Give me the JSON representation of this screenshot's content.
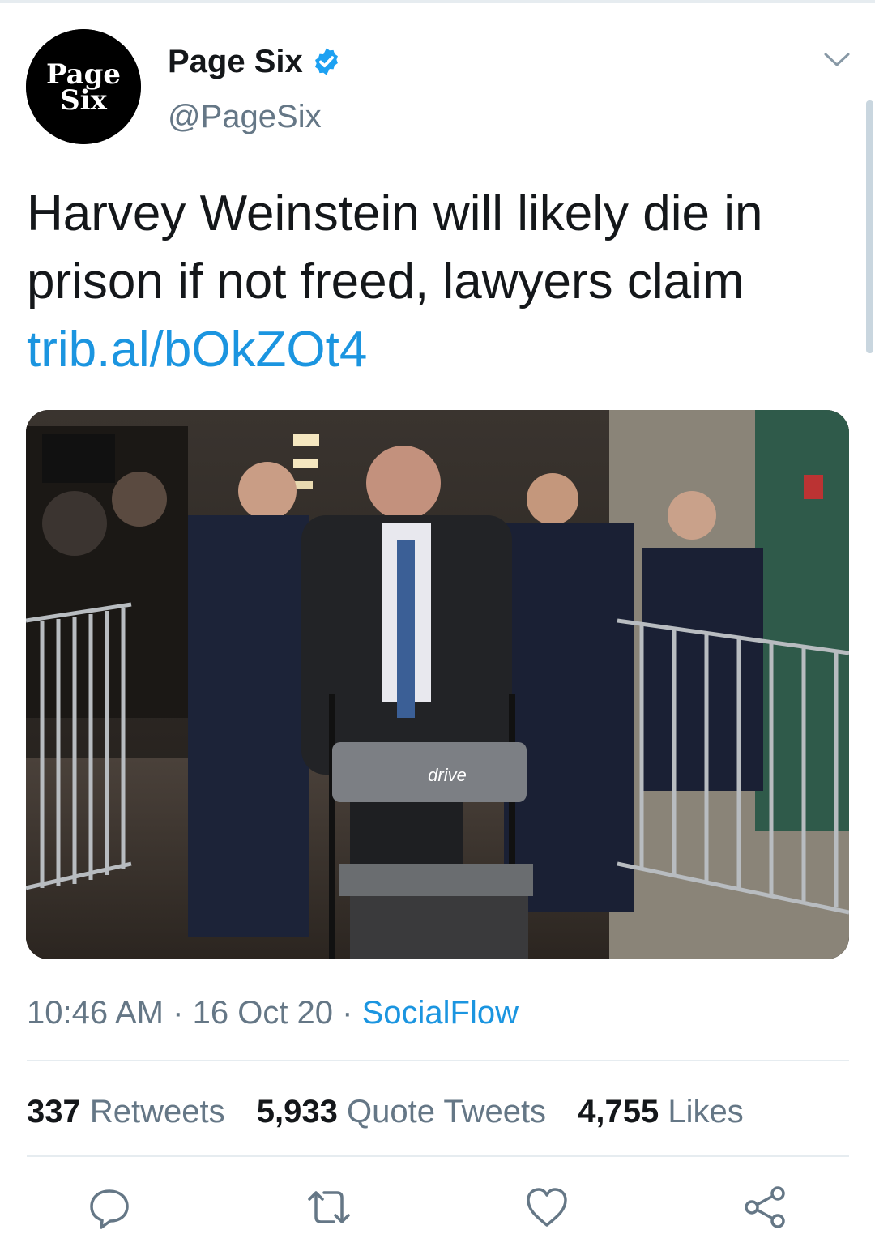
{
  "tweet": {
    "author": {
      "display_name": "Page Six",
      "handle": "@PageSix",
      "avatar_text_line1": "Page",
      "avatar_text_line2": "Six",
      "verified": true
    },
    "text": "Harvey Weinstein will likely die in prison if not freed, lawyers claim",
    "link": "trib.al/bOkZOt4",
    "media": {
      "walker_brand": "drive"
    },
    "time": "10:46 AM",
    "date": "16 Oct 20",
    "separator": "·",
    "source": "SocialFlow",
    "stats": {
      "retweets_count": "337",
      "retweets_label": "Retweets",
      "quotes_count": "5,933",
      "quotes_label": "Quote Tweets",
      "likes_count": "4,755",
      "likes_label": "Likes"
    }
  },
  "colors": {
    "link": "#1b95e0",
    "secondary_text": "#657786",
    "primary_text": "#14171a",
    "divider": "#e6ecf0"
  },
  "icons": [
    "verified-badge-icon",
    "chevron-down-icon",
    "reply-icon",
    "retweet-icon",
    "like-icon",
    "share-icon"
  ]
}
